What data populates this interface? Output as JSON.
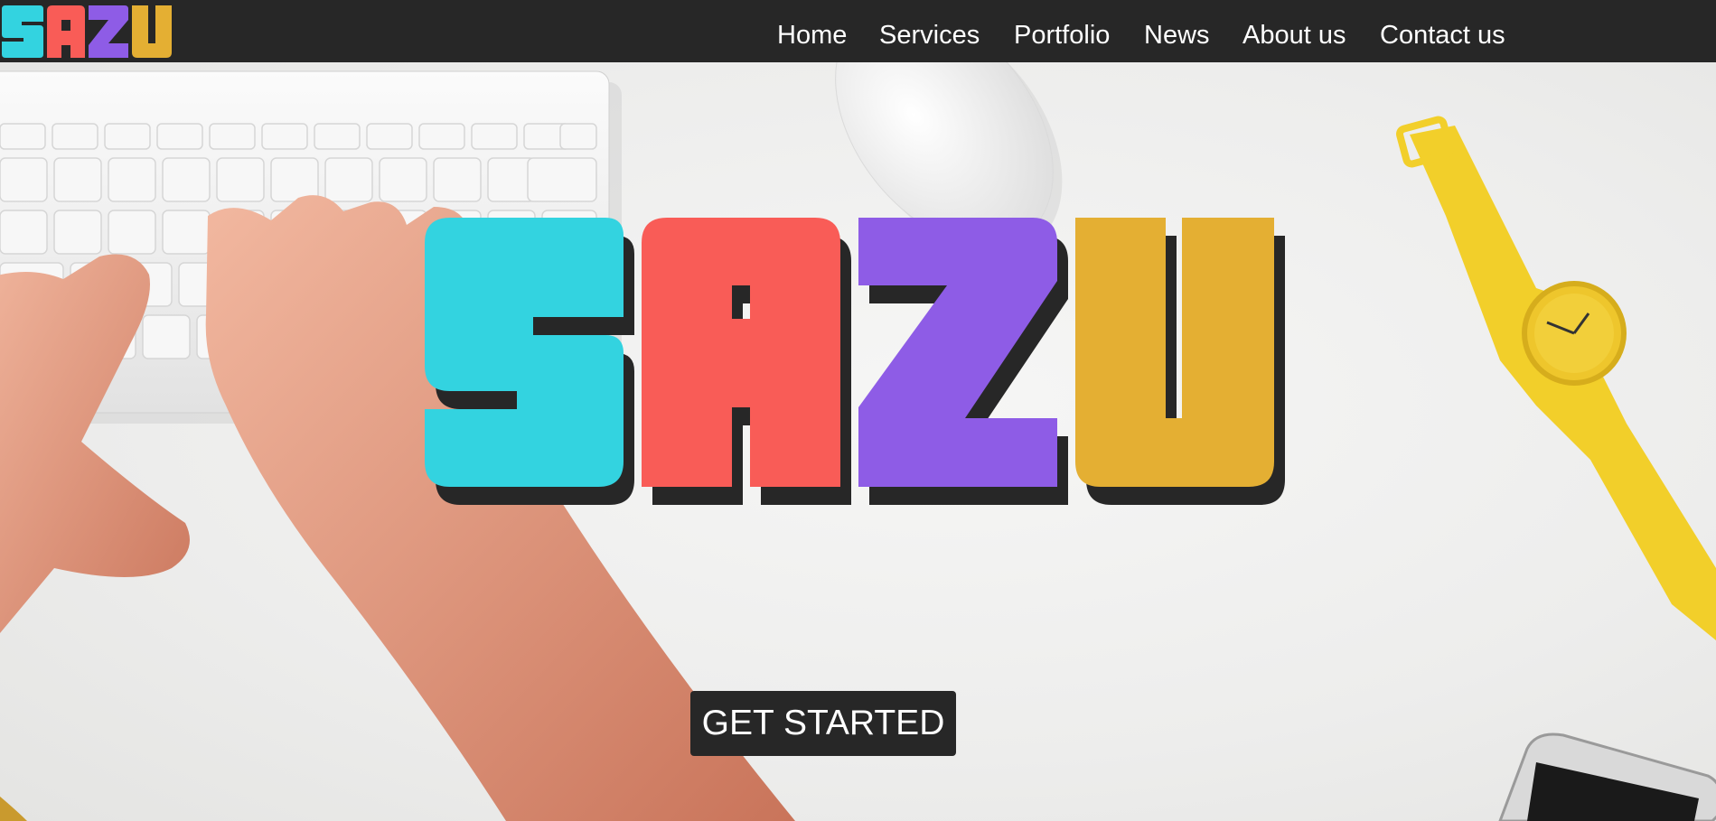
{
  "brand": {
    "name": "SAZU",
    "letters": [
      "S",
      "A",
      "Z",
      "U"
    ],
    "colors": [
      "#33d3e0",
      "#f95c57",
      "#8e5ce6",
      "#e4af33"
    ],
    "shadow_color": "#272727"
  },
  "nav": {
    "items": [
      {
        "label": "Home"
      },
      {
        "label": "Services"
      },
      {
        "label": "Portfolio"
      },
      {
        "label": "News"
      },
      {
        "label": "About us"
      },
      {
        "label": "Contact us"
      }
    ]
  },
  "hero": {
    "cta_label": "GET STARTED"
  },
  "theme": {
    "nav_bg": "#272727",
    "nav_text": "#ffffff",
    "button_bg": "#272727",
    "button_text": "#ffffff"
  },
  "icons": [
    "keyboard-image",
    "mouse-image",
    "watch-image",
    "phone-image",
    "hands-image"
  ]
}
